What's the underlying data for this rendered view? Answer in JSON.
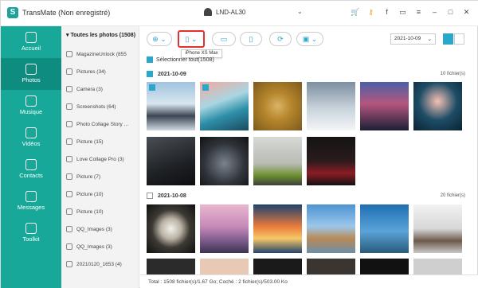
{
  "title_bar": {
    "app_title": "TransMate (Non enregistré)",
    "device_name": "LND-AL30",
    "icons": [
      "cart-icon",
      "key-icon",
      "facebook-icon",
      "chat-icon",
      "menu-icon",
      "minimize-icon",
      "maximize-icon",
      "close-icon"
    ]
  },
  "nav": {
    "items": [
      {
        "label": "Accueil",
        "icon": "home-icon",
        "active": false
      },
      {
        "label": "Photos",
        "icon": "photo-icon",
        "active": true
      },
      {
        "label": "Musique",
        "icon": "music-icon",
        "active": false
      },
      {
        "label": "Vidéos",
        "icon": "video-icon",
        "active": false
      },
      {
        "label": "Contacts",
        "icon": "contacts-icon",
        "active": false
      },
      {
        "label": "Messages",
        "icon": "messages-icon",
        "active": false
      },
      {
        "label": "Toolkit",
        "icon": "toolkit-icon",
        "active": false
      }
    ],
    "accent": "#17a899"
  },
  "albums": {
    "header": "Toutes les photos (1508)",
    "items": [
      "MagazineUnlock (855",
      "Pictures (34)",
      "Camera (3)",
      "Screenshots (64)",
      "Photo Collage Story ...",
      "Picture (15)",
      "Love Collage Pro (3)",
      "Picture (7)",
      "Picture (10)",
      "Picture (10)",
      "QQ_Images (3)",
      "QQ_Images (3)",
      "20210120_1653 (4)"
    ]
  },
  "toolbar": {
    "tooltip": "iPhone XS Max",
    "date_value": "2021-10-09"
  },
  "content": {
    "select_all": "Sélectionner tout(1508)",
    "groups": [
      {
        "date": "2021-10-09",
        "count": "10 fichier(s)"
      },
      {
        "date": "2021-10-08",
        "count": "20 fichier(s)"
      }
    ]
  },
  "status": "Total : 1508 fichier(s)/1.67 Go; Coché : 2 fichier(s)/503.00 Ko"
}
